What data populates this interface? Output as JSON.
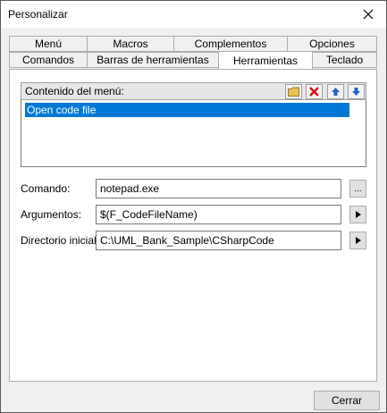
{
  "window": {
    "title": "Personalizar"
  },
  "tabs": {
    "row1": [
      "Menú",
      "Macros",
      "Complementos",
      "Opciones"
    ],
    "row2": [
      "Comandos",
      "Barras de herramientas",
      "Herramientas",
      "Teclado"
    ],
    "active": "Herramientas"
  },
  "menu_contents": {
    "label": "Contenido del menú:",
    "toolbar_icons": [
      "new-folder-icon",
      "delete-icon",
      "move-up-icon",
      "move-down-icon"
    ],
    "items": [
      "Open code file"
    ],
    "selected_item": "Open code file"
  },
  "fields": {
    "command": {
      "label": "Comando:",
      "value": "notepad.exe",
      "button": "..."
    },
    "arguments": {
      "label": "Argumentos:",
      "value": "$(F_CodeFileName)"
    },
    "initial_dir": {
      "label": "Directorio inicial:",
      "value": "C:\\UML_Bank_Sample\\CSharpCode"
    }
  },
  "footer": {
    "close_label": "Cerrar"
  },
  "colors": {
    "selection": "#0078d7",
    "delete_red": "#d4111c",
    "arrow_blue": "#1f63c7",
    "folder_yellow": "#e8c35a"
  }
}
